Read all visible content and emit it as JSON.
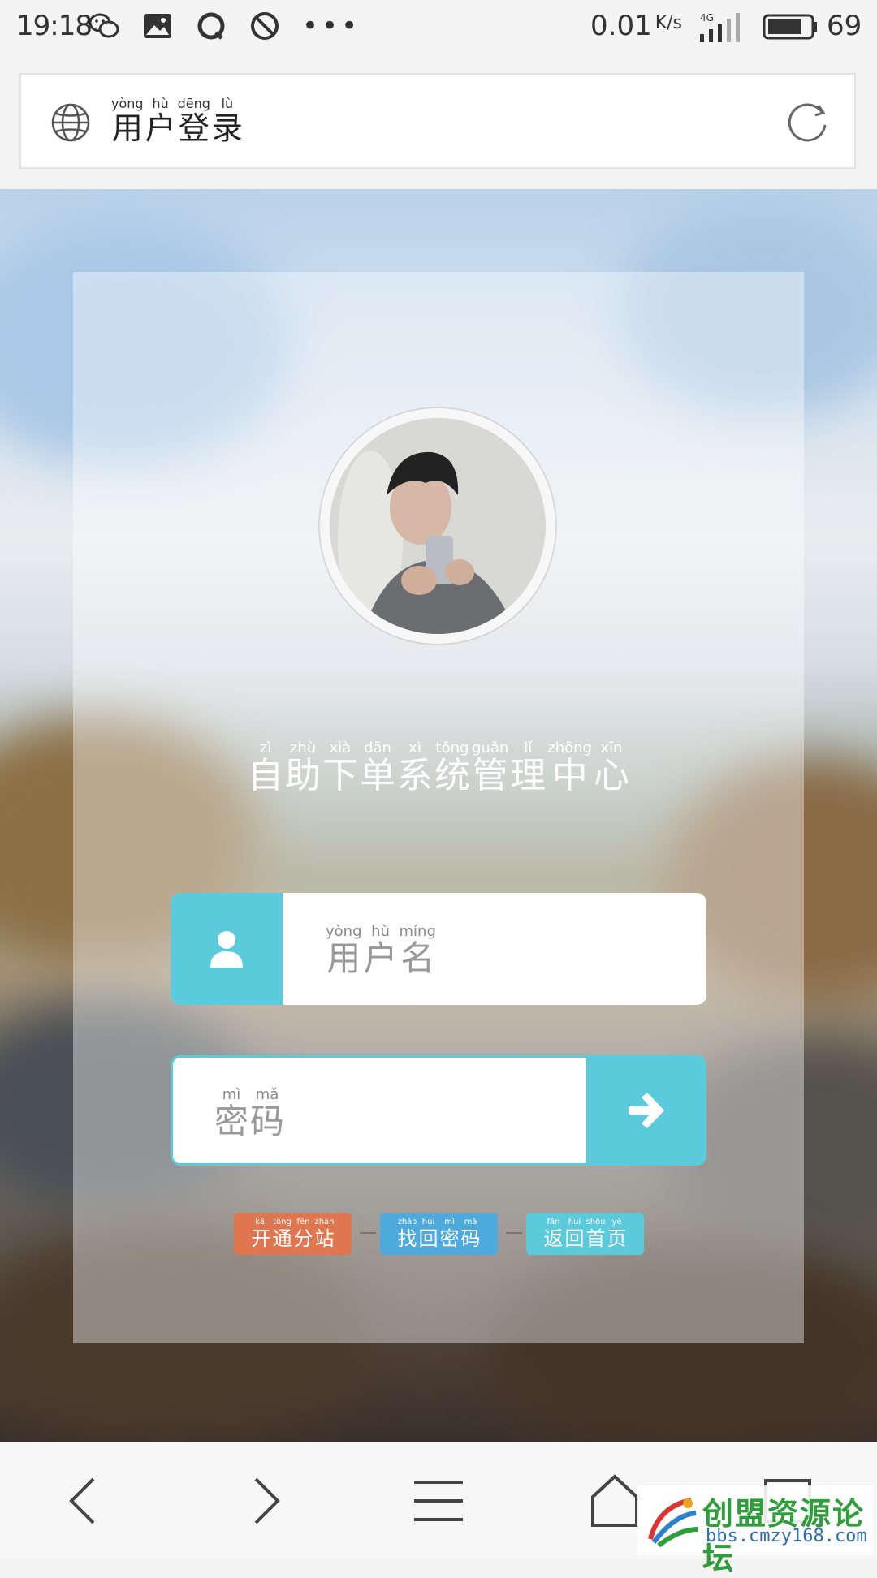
{
  "status_bar": {
    "time": "19:18",
    "speed": "0.01",
    "speed_unit": "K/s",
    "network": "4G",
    "battery": "69",
    "icons": [
      "wechat-icon",
      "gallery-icon",
      "qq-icon",
      "no-disturb-icon",
      "more-dots-icon"
    ]
  },
  "address_bar": {
    "title_chars": [
      "用",
      "户",
      "登",
      "录"
    ],
    "title_pinyin": [
      "yòng",
      "hù",
      "dēng",
      "lù"
    ]
  },
  "login": {
    "system_title_chars": [
      "自",
      "助",
      "下",
      "单",
      "系",
      "统",
      "管",
      "理",
      "中",
      "心"
    ],
    "system_title_pinyin": [
      "zì",
      "zhù",
      "xià",
      "dān",
      "xì",
      "tǒng",
      "guǎn",
      "lǐ",
      "zhōng",
      "xīn"
    ],
    "username_placeholder_chars": [
      "用",
      "户",
      "名"
    ],
    "username_placeholder_pinyin": [
      "yòng",
      "hù",
      "míng"
    ],
    "password_placeholder_chars": [
      "密",
      "码"
    ],
    "password_placeholder_pinyin": [
      "mì",
      "mǎ"
    ]
  },
  "links": [
    {
      "chars": [
        "开",
        "通",
        "分",
        "站"
      ],
      "pinyin": [
        "kāi",
        "tōng",
        "fēn",
        "zhàn"
      ],
      "color": "#e07650"
    },
    {
      "chars": [
        "找",
        "回",
        "密",
        "码"
      ],
      "pinyin": [
        "zhǎo",
        "huí",
        "mì",
        "mǎ"
      ],
      "color": "#4ea9dc"
    },
    {
      "chars": [
        "返",
        "回",
        "首",
        "页"
      ],
      "pinyin": [
        "fǎn",
        "huí",
        "shǒu",
        "yè"
      ],
      "color": "#5bcadb"
    }
  ],
  "watermark": {
    "title": "创盟资源论坛",
    "url": "bbs.cmzy168.com"
  },
  "colors": {
    "accent": "#5bcadb",
    "link_orange": "#e07650",
    "link_blue": "#4ea9dc"
  }
}
